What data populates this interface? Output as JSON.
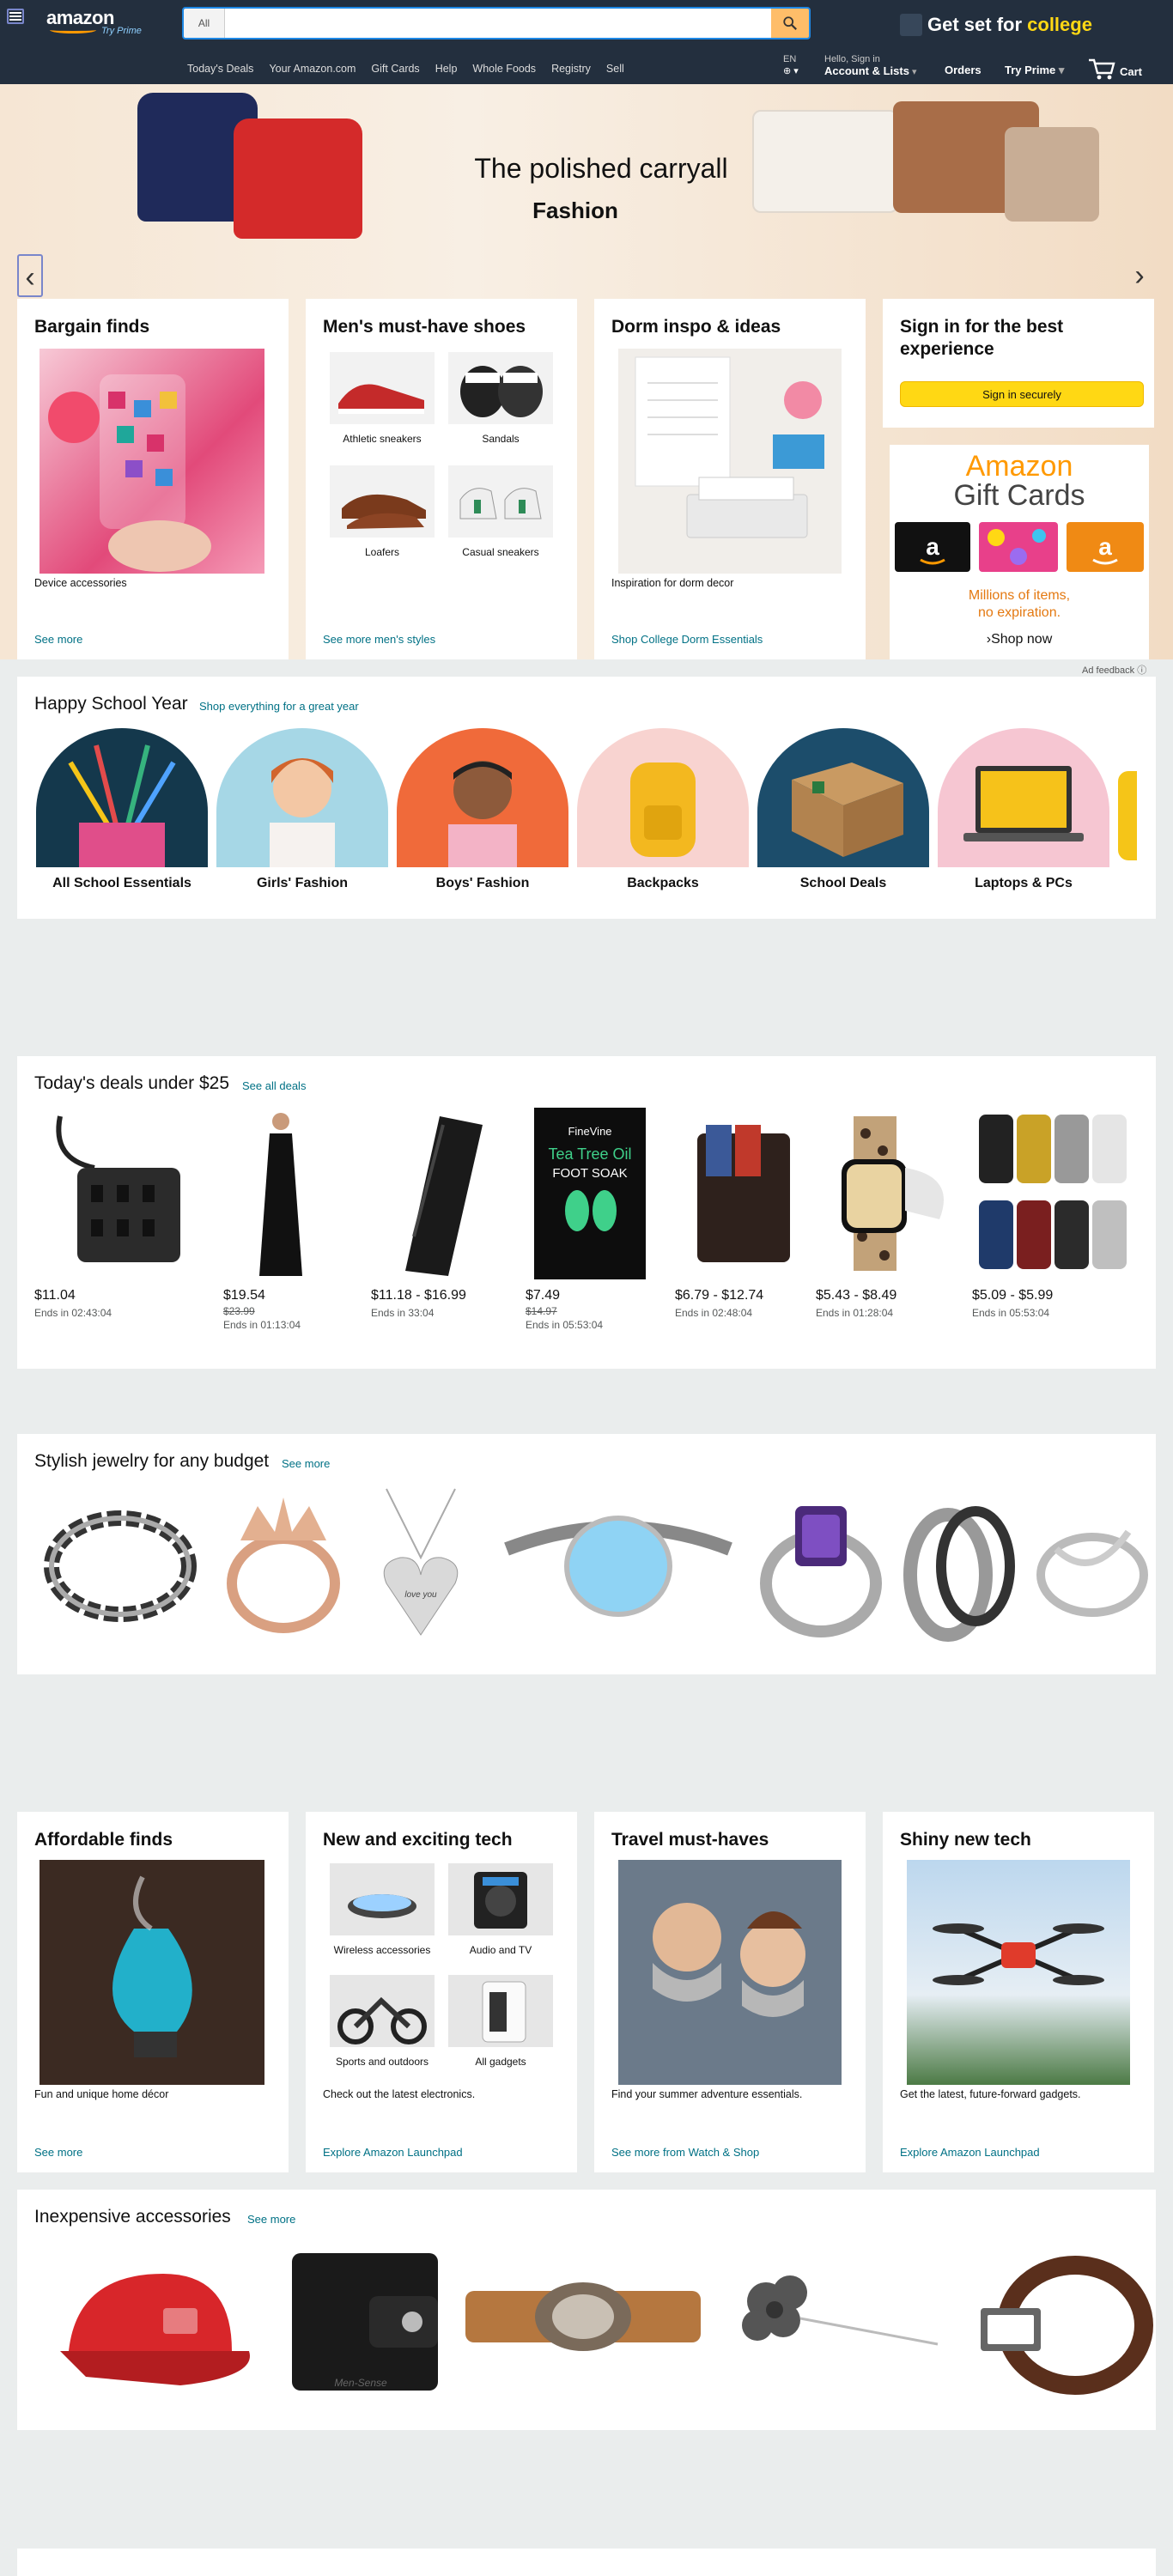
{
  "header": {
    "logo_text": "amazon",
    "prime_text": "Try Prime",
    "search_dept": "All",
    "search_placeholder": "",
    "promo_text_a": "Get set for ",
    "promo_text_b": "college",
    "nav_links": [
      "Today's Deals",
      "Your Amazon.com",
      "Gift Cards",
      "Help",
      "Whole Foods",
      "Registry",
      "Sell"
    ],
    "lang": "EN",
    "greeting": "Hello, Sign in",
    "account": "Account & Lists",
    "orders": "Orders",
    "try_prime": "Try Prime",
    "cart": "Cart"
  },
  "hero": {
    "headline": "The polished carryall",
    "sub": "Fashion"
  },
  "cards": {
    "bargain": {
      "title": "Bargain finds",
      "caption": "Device accessories",
      "link": "See more"
    },
    "shoes": {
      "title": "Men's must-have shoes",
      "items": [
        "Athletic sneakers",
        "Sandals",
        "Loafers",
        "Casual sneakers"
      ],
      "link": "See more men's styles"
    },
    "dorm": {
      "title": "Dorm inspo & ideas",
      "caption": "Inspiration for dorm decor",
      "link": "Shop College Dorm Essentials"
    },
    "signin": {
      "title": "Sign in for the best experience",
      "button": "Sign in securely"
    },
    "gift": {
      "line1": "Amazon",
      "line2": "Gift Cards",
      "text1": "Millions of items,",
      "text2": "no expiration.",
      "shop": "›Shop now"
    }
  },
  "ad_feedback": "Ad feedback",
  "school": {
    "title": "Happy School Year",
    "link": "Shop everything for a great year",
    "items": [
      "All School Essentials",
      "Girls' Fashion",
      "Boys' Fashion",
      "Backpacks",
      "School Deals",
      "Laptops & PCs"
    ]
  },
  "deals": {
    "title": "Today's deals under $25",
    "link": "See all deals",
    "items": [
      {
        "price": "$11.04",
        "strike": "",
        "ends": "Ends in 02:43:04"
      },
      {
        "price": "$19.54",
        "strike": "$23.99",
        "ends": "Ends in 01:13:04"
      },
      {
        "price": "$11.18 - $16.99",
        "strike": "",
        "ends": "Ends in 33:04"
      },
      {
        "price": "$7.49",
        "strike": "$14.97",
        "ends": "Ends in 05:53:04"
      },
      {
        "price": "$6.79 - $12.74",
        "strike": "",
        "ends": "Ends in 02:48:04"
      },
      {
        "price": "$5.43 - $8.49",
        "strike": "",
        "ends": "Ends in 01:28:04"
      },
      {
        "price": "$5.09 - $5.99",
        "strike": "",
        "ends": "Ends in 05:53:04"
      }
    ],
    "foot_soak_line1": "Tea Tree Oil",
    "foot_soak_line2": "FOOT SOAK",
    "foot_soak_brand": "FineVine"
  },
  "jewelry": {
    "title": "Stylish jewelry for any budget",
    "link": "See more",
    "pendant_text": "love you"
  },
  "cards2": {
    "affordable": {
      "title": "Affordable finds",
      "caption": "Fun and unique home décor",
      "link": "See more"
    },
    "tech": {
      "title": "New and exciting tech",
      "items": [
        "Wireless accessories",
        "Audio and TV",
        "Sports and outdoors",
        "All gadgets"
      ],
      "caption": "Check out the latest electronics.",
      "link": "Explore Amazon Launchpad"
    },
    "travel": {
      "title": "Travel must-haves",
      "caption": "Find your summer adventure essentials.",
      "link": "See more from Watch & Shop"
    },
    "shiny": {
      "title": "Shiny new tech",
      "caption": "Get the latest, future-forward gadgets.",
      "link": "Explore Amazon Launchpad"
    }
  },
  "accessories": {
    "title": "Inexpensive accessories",
    "link": "See more",
    "wallet_brand": "Men-Sense"
  },
  "colors": {
    "nav": "#232f3e",
    "link": "#007185",
    "accent": "#ff9900",
    "button": "#ffd814"
  }
}
